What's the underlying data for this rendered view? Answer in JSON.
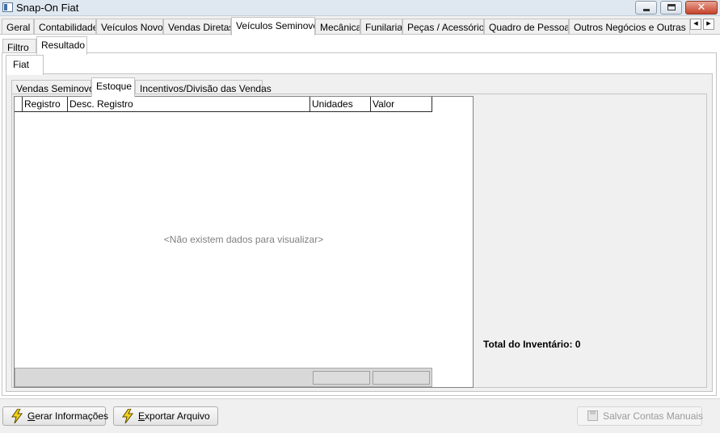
{
  "window": {
    "title": "Snap-On Fiat"
  },
  "main_tabs": [
    {
      "label": "Geral"
    },
    {
      "label": "Contabilidade"
    },
    {
      "label": "Veículos Novos"
    },
    {
      "label": "Vendas Diretas"
    },
    {
      "label": "Veículos Seminovos",
      "active": true
    },
    {
      "label": "Mecânica"
    },
    {
      "label": "Funilaria"
    },
    {
      "label": "Peças / Acessórios"
    },
    {
      "label": "Quadro de Pessoas"
    },
    {
      "label": "Outros Negócios e Outras Mar"
    }
  ],
  "sub_tabs": [
    {
      "label": "Filtro"
    },
    {
      "label": "Resultado",
      "active": true
    }
  ],
  "brand_tab": {
    "label": "Fiat"
  },
  "inner_tabs": [
    {
      "label": "Vendas Seminovos"
    },
    {
      "label": "Estoque",
      "active": true
    },
    {
      "label": "Incentivos/Divisão das Vendas"
    }
  ],
  "grid": {
    "columns": [
      "Registro",
      "Desc. Registro",
      "Unidades",
      "Valor"
    ],
    "empty_message": "<Não existem dados para visualizar>"
  },
  "total": {
    "label": "Total do Inventário:",
    "value": "0"
  },
  "buttons": {
    "gerar": {
      "prefix_underlined": "G",
      "rest": "erar Informações"
    },
    "exportar": {
      "prefix_underlined": "E",
      "rest": "xportar Arquivo"
    },
    "salvar": {
      "label": "Salvar Contas Manuais"
    }
  },
  "colors": {
    "bolt": "#f2d31b",
    "bolt_outline": "#5a4a00",
    "close_button": "#c6422a"
  }
}
